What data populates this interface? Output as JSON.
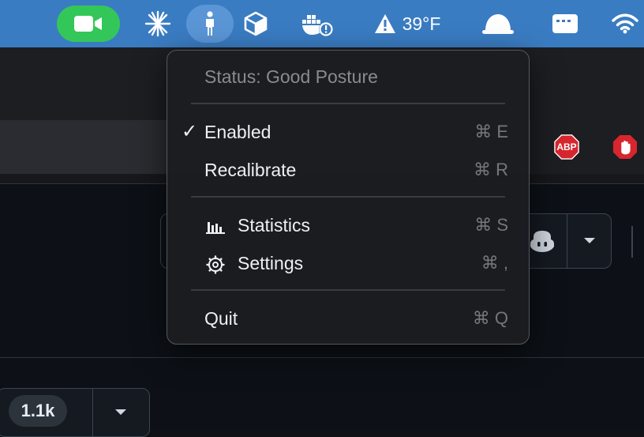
{
  "menubar": {
    "weather_text": "39°F",
    "icons": [
      "facetime-video-icon",
      "perplexity-asterisk-icon",
      "posture-person-icon",
      "package-box-icon",
      "docker-whale-icon",
      "warning-icon",
      "dome-app-icon",
      "menu-window-icon",
      "wifi-icon"
    ]
  },
  "extensions": {
    "abp_label": "ABP"
  },
  "status_menu": {
    "status_text": "Status: Good Posture",
    "items": [
      {
        "label": "Enabled",
        "shortcut": "⌘ E",
        "checked": true
      },
      {
        "label": "Recalibrate",
        "shortcut": "⌘ R"
      },
      {
        "label": "Statistics",
        "shortcut": "⌘ S",
        "icon": "bar-chart-icon"
      },
      {
        "label": "Settings",
        "shortcut": "⌘ ,",
        "icon": "gear-icon"
      },
      {
        "label": "Quit",
        "shortcut": "⌘ Q"
      }
    ]
  },
  "repo": {
    "star_count": "1.1k"
  },
  "colors": {
    "menubar": "#3a7cc2",
    "facetime_green": "#33c759",
    "abp_red": "#d7262d",
    "menu_bg": "#1c1d21"
  }
}
